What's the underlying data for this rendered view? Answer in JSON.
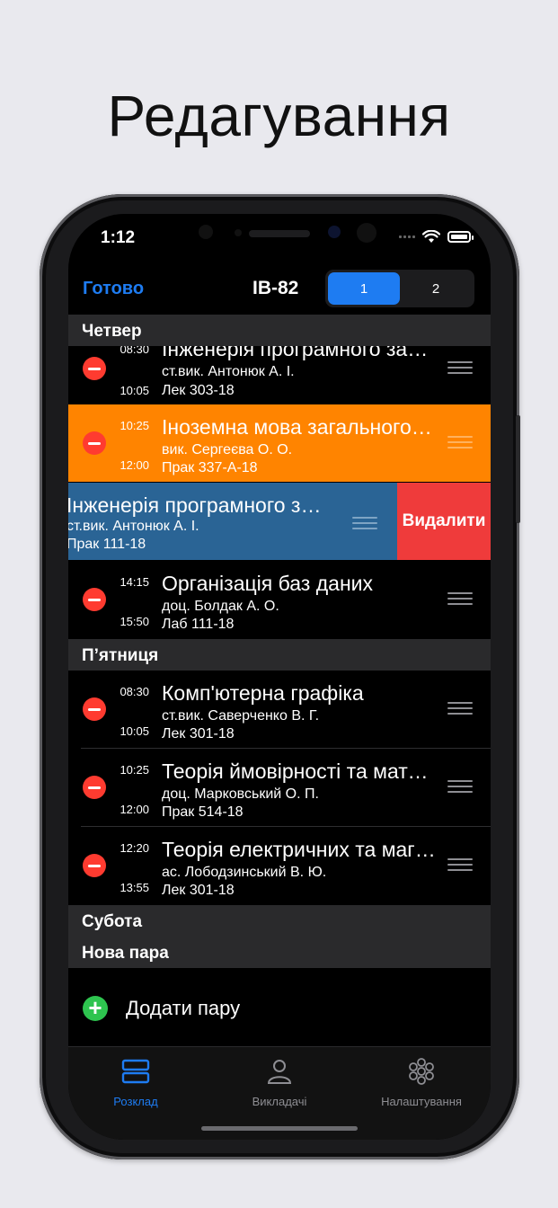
{
  "headline": "Редагування",
  "status": {
    "time": "1:12"
  },
  "nav": {
    "done": "Готово",
    "title": "ІВ-82",
    "segments": [
      "1",
      "2"
    ],
    "selected_segment": "1"
  },
  "days": [
    {
      "name": "Четвер",
      "lessons": [
        {
          "start": "08:30",
          "end": "10:05",
          "title": "Інженерія програмного забезпечення",
          "teacher": "ст.вик. Антонюк А. І.",
          "room": "Лек 303-18",
          "style": "normal"
        },
        {
          "start": "10:25",
          "end": "12:00",
          "title": "Іноземна мова загального спрямування",
          "teacher": "вик. Сергеєва О. О.",
          "room": "Прак 337-А-18",
          "style": "highlighted"
        },
        {
          "title": "Інженерія програмного забезпечення",
          "teacher": "ст.вик. Антонюк А. І.",
          "room": "Прак 111-18",
          "style": "swiped",
          "delete_label": "Видалити"
        },
        {
          "start": "14:15",
          "end": "15:50",
          "title": "Організація баз даних",
          "teacher": "доц. Болдак А. О.",
          "room": "Лаб 111-18",
          "style": "normal"
        }
      ]
    },
    {
      "name": "П’ятниця",
      "lessons": [
        {
          "start": "08:30",
          "end": "10:05",
          "title": "Комп'ютерна графіка",
          "teacher": "ст.вик. Саверченко В. Г.",
          "room": "Лек 301-18",
          "style": "normal"
        },
        {
          "start": "10:25",
          "end": "12:00",
          "title": "Теорія ймовірності та математична статистика",
          "teacher": "доц. Марковський О. П.",
          "room": "Прак 514-18",
          "style": "normal"
        },
        {
          "start": "12:20",
          "end": "13:55",
          "title": "Теорія електричних та магнітних кіл",
          "teacher": "ас. Лободзинський В. Ю.",
          "room": "Лек 301-18",
          "style": "normal"
        }
      ]
    },
    {
      "name": "Субота",
      "lessons": []
    },
    {
      "name": "Нова пара",
      "lessons": []
    }
  ],
  "add_pair": "Додати пару",
  "tabs": [
    {
      "label": "Розклад",
      "icon": "schedule-icon",
      "active": true
    },
    {
      "label": "Викладачі",
      "icon": "person-icon",
      "active": false
    },
    {
      "label": "Налаштування",
      "icon": "settings-icon",
      "active": false
    }
  ],
  "colors": {
    "accent": "#1e7cf2",
    "highlight_row": "#ff8400",
    "swiped_row": "#2a6495",
    "delete": "#ef3b3b",
    "minus": "#ff3b30",
    "plus": "#2ec44f"
  }
}
